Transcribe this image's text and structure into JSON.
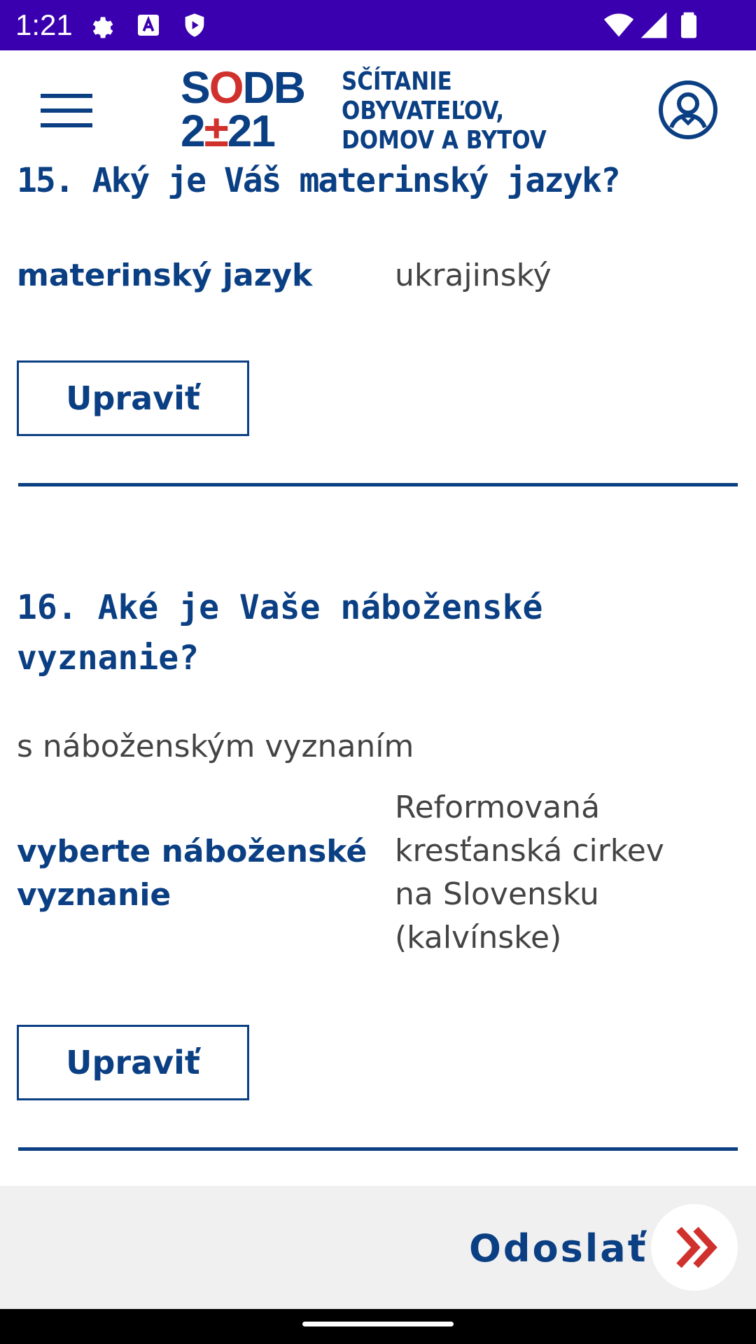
{
  "status_bar": {
    "time": "1:21",
    "icons": [
      "gear-icon",
      "text-a-icon",
      "shield-play-icon"
    ],
    "right_icons": [
      "wifi-icon",
      "signal-icon",
      "battery-icon"
    ]
  },
  "header": {
    "logo_mark_top": "SODB",
    "logo_mark_bottom": "2±21",
    "logo_line1": "SČÍTANIE",
    "logo_line2": "OBYVATEĽOV,",
    "logo_line3": "DOMOV A BYTOV",
    "menu_icon": "hamburger-menu-icon",
    "profile_icon": "user-profile-icon"
  },
  "q15": {
    "title": "15. Aký je Váš materinský jazyk?",
    "label": "materinský jazyk",
    "value": "ukrajinský",
    "edit_label": "Upraviť"
  },
  "q16": {
    "title_line1": "16. Aké je Vaše náboženské",
    "title_line2": "vyznanie?",
    "subtitle": "s náboženským vyznaním",
    "label_line1": "vyberte náboženské",
    "label_line2": "vyznanie",
    "value_lines": [
      "Reformovaná",
      "kresťanská cirkev",
      "na Slovensku",
      "(kalvínske)"
    ],
    "edit_label": "Upraviť"
  },
  "footer": {
    "submit_label": "Odoslať",
    "submit_icon": "double-chevron-right-icon"
  },
  "colors": {
    "status_bar": "#3a00b0",
    "primary": "#0b3f83",
    "accent_red": "#d0312d",
    "text_gray": "#444444",
    "footer_bg": "#f0f0f0"
  }
}
